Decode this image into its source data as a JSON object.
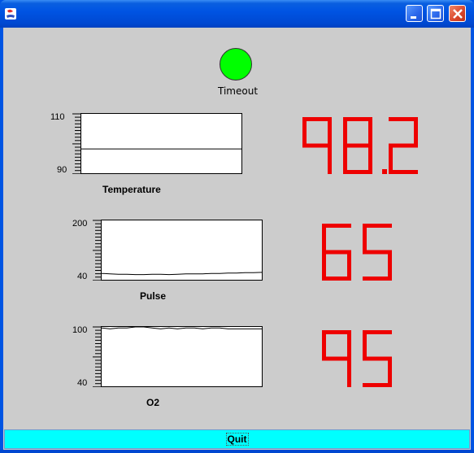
{
  "window": {
    "title": "",
    "buttons": [
      "minimize",
      "maximize",
      "close"
    ]
  },
  "status": {
    "label": "Timeout",
    "color": "#00ff00"
  },
  "monitors": [
    {
      "name": "Temperature",
      "y_max": "110",
      "y_min": "90",
      "readout": "98.2",
      "trace": [
        98.2,
        98.2,
        98.2,
        98.2,
        98.2,
        98.2,
        98.2,
        98.2,
        98.2,
        98.2,
        98.2,
        98.2,
        98.2,
        98.2,
        98.2,
        98.2,
        98.2,
        98.2,
        98.2,
        98.2
      ]
    },
    {
      "name": "Pulse",
      "y_max": "200",
      "y_min": "40",
      "readout": "65",
      "trace": [
        57,
        56,
        55,
        55,
        54,
        54,
        55,
        55,
        54,
        55,
        56,
        56,
        56,
        57,
        57,
        58,
        58,
        59,
        59,
        60
      ]
    },
    {
      "name": "O2",
      "y_max": "100",
      "y_min": "40",
      "readout": "95",
      "trace": [
        99,
        98,
        99,
        99,
        100,
        100,
        99,
        98,
        99,
        98,
        99,
        99,
        98,
        99,
        99,
        98,
        98,
        98,
        98,
        98
      ]
    }
  ],
  "readout_color": "#ee0000",
  "quit_label": "Quit"
}
